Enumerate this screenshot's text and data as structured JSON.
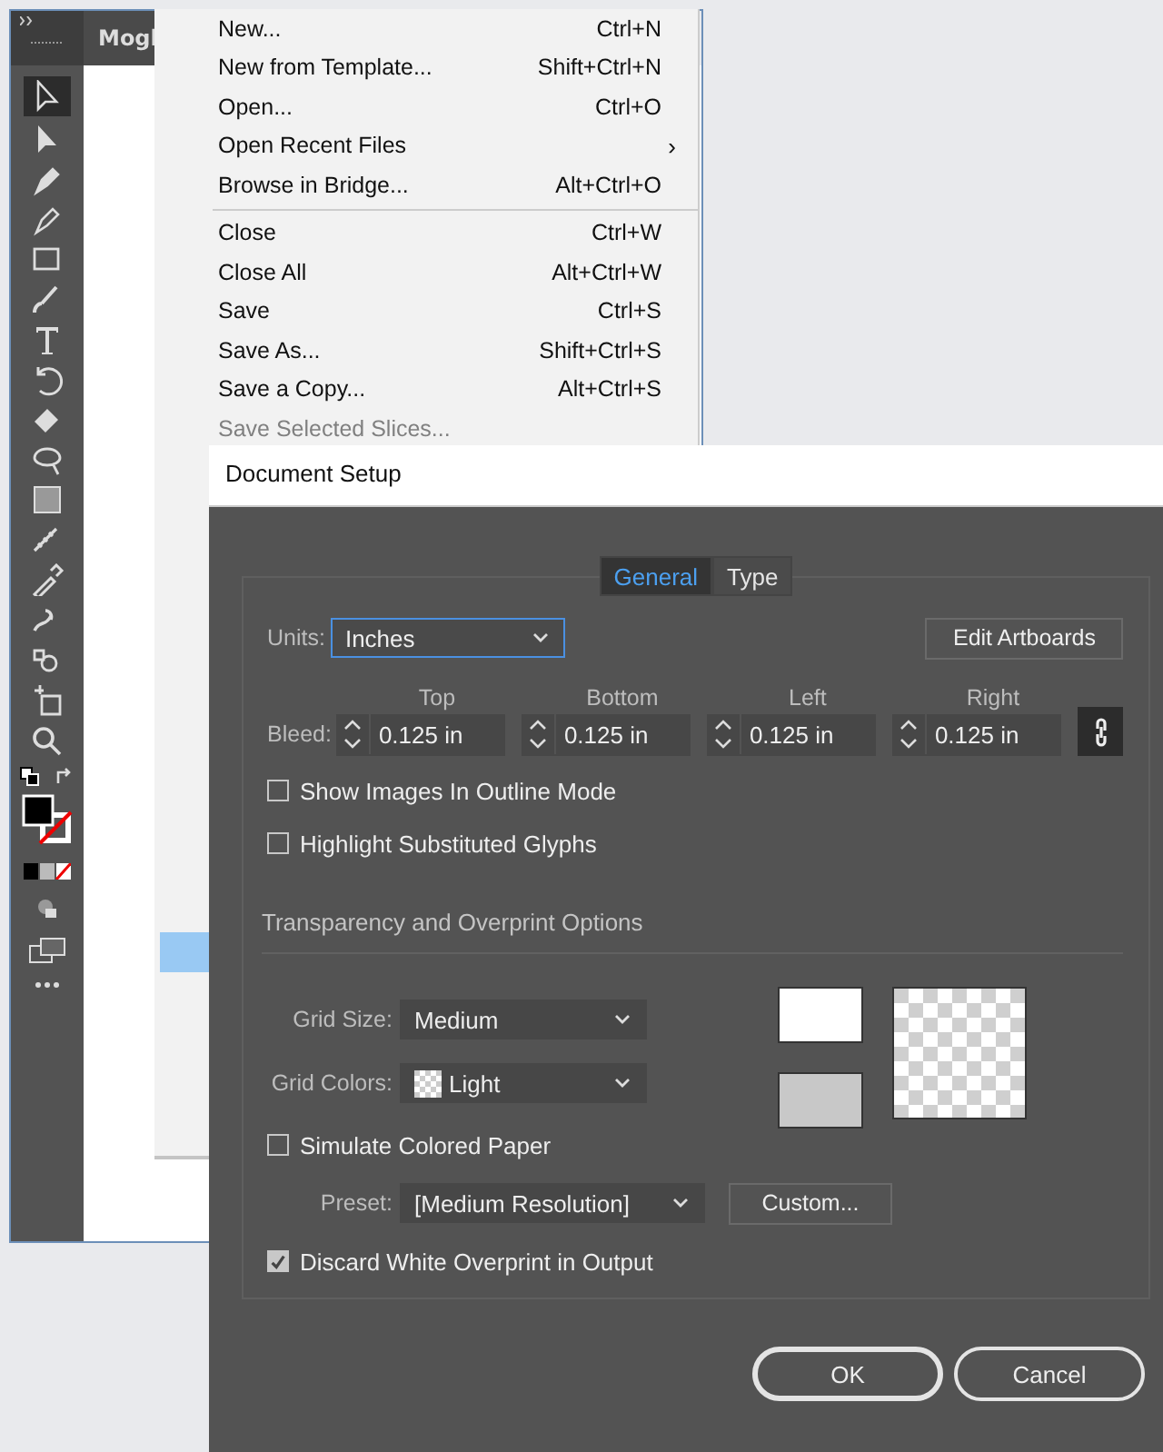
{
  "app_window": {
    "document_tab": "Mogl"
  },
  "file_menu": {
    "items": [
      {
        "label": "New...",
        "shortcut": "Ctrl+N",
        "disabled": false,
        "separator_before": false
      },
      {
        "label": "New from Template...",
        "shortcut": "Shift+Ctrl+N",
        "disabled": false,
        "separator_before": false
      },
      {
        "label": "Open...",
        "shortcut": "Ctrl+O",
        "disabled": false,
        "separator_before": false
      },
      {
        "label": "Open Recent Files",
        "submenu": "›",
        "disabled": false,
        "separator_before": false
      },
      {
        "label": "Browse in Bridge...",
        "shortcut": "Alt+Ctrl+O",
        "disabled": false,
        "separator_before": false
      },
      {
        "label": "Close",
        "shortcut": "Ctrl+W",
        "disabled": false,
        "separator_before": true
      },
      {
        "label": "Close All",
        "shortcut": "Alt+Ctrl+W",
        "disabled": false,
        "separator_before": false
      },
      {
        "label": "Save",
        "shortcut": "Ctrl+S",
        "disabled": false,
        "separator_before": false
      },
      {
        "label": "Save As...",
        "shortcut": "Shift+Ctrl+S",
        "disabled": false,
        "separator_before": false
      },
      {
        "label": "Save a Copy...",
        "shortcut": "Alt+Ctrl+S",
        "disabled": false,
        "separator_before": false
      },
      {
        "label": "Save Selected Slices...",
        "disabled": true,
        "separator_before": false
      }
    ],
    "hidden_highlighted_row": true
  },
  "dialog": {
    "title": "Document Setup",
    "tabs": [
      {
        "label": "General",
        "selected": true
      },
      {
        "label": "Type",
        "selected": false
      }
    ],
    "units": {
      "label": "Units:",
      "value": "Inches"
    },
    "edit_artboards_button": "Edit Artboards",
    "bleed": {
      "label": "Bleed:",
      "linked": true,
      "fields": [
        {
          "header": "Top",
          "value": "0.125 in"
        },
        {
          "header": "Bottom",
          "value": "0.125 in"
        },
        {
          "header": "Left",
          "value": "0.125 in"
        },
        {
          "header": "Right",
          "value": "0.125 in"
        }
      ]
    },
    "options": [
      {
        "label": "Show Images In Outline Mode",
        "checked": false
      },
      {
        "label": "Highlight Substituted Glyphs",
        "checked": false
      }
    ],
    "transparency": {
      "title": "Transparency and Overprint Options",
      "grid_size": {
        "label": "Grid Size:",
        "value": "Medium"
      },
      "grid_colors": {
        "label": "Grid Colors:",
        "value": "Light"
      },
      "simulate_paper": {
        "label": "Simulate Colored Paper",
        "checked": false
      },
      "preset": {
        "label": "Preset:",
        "value": "[Medium Resolution]"
      },
      "custom_button": "Custom...",
      "discard_white": {
        "label": "Discard White Overprint in Output",
        "checked": true
      }
    },
    "buttons": [
      {
        "label": "OK",
        "default": true
      },
      {
        "label": "Cancel",
        "default": false
      }
    ]
  }
}
